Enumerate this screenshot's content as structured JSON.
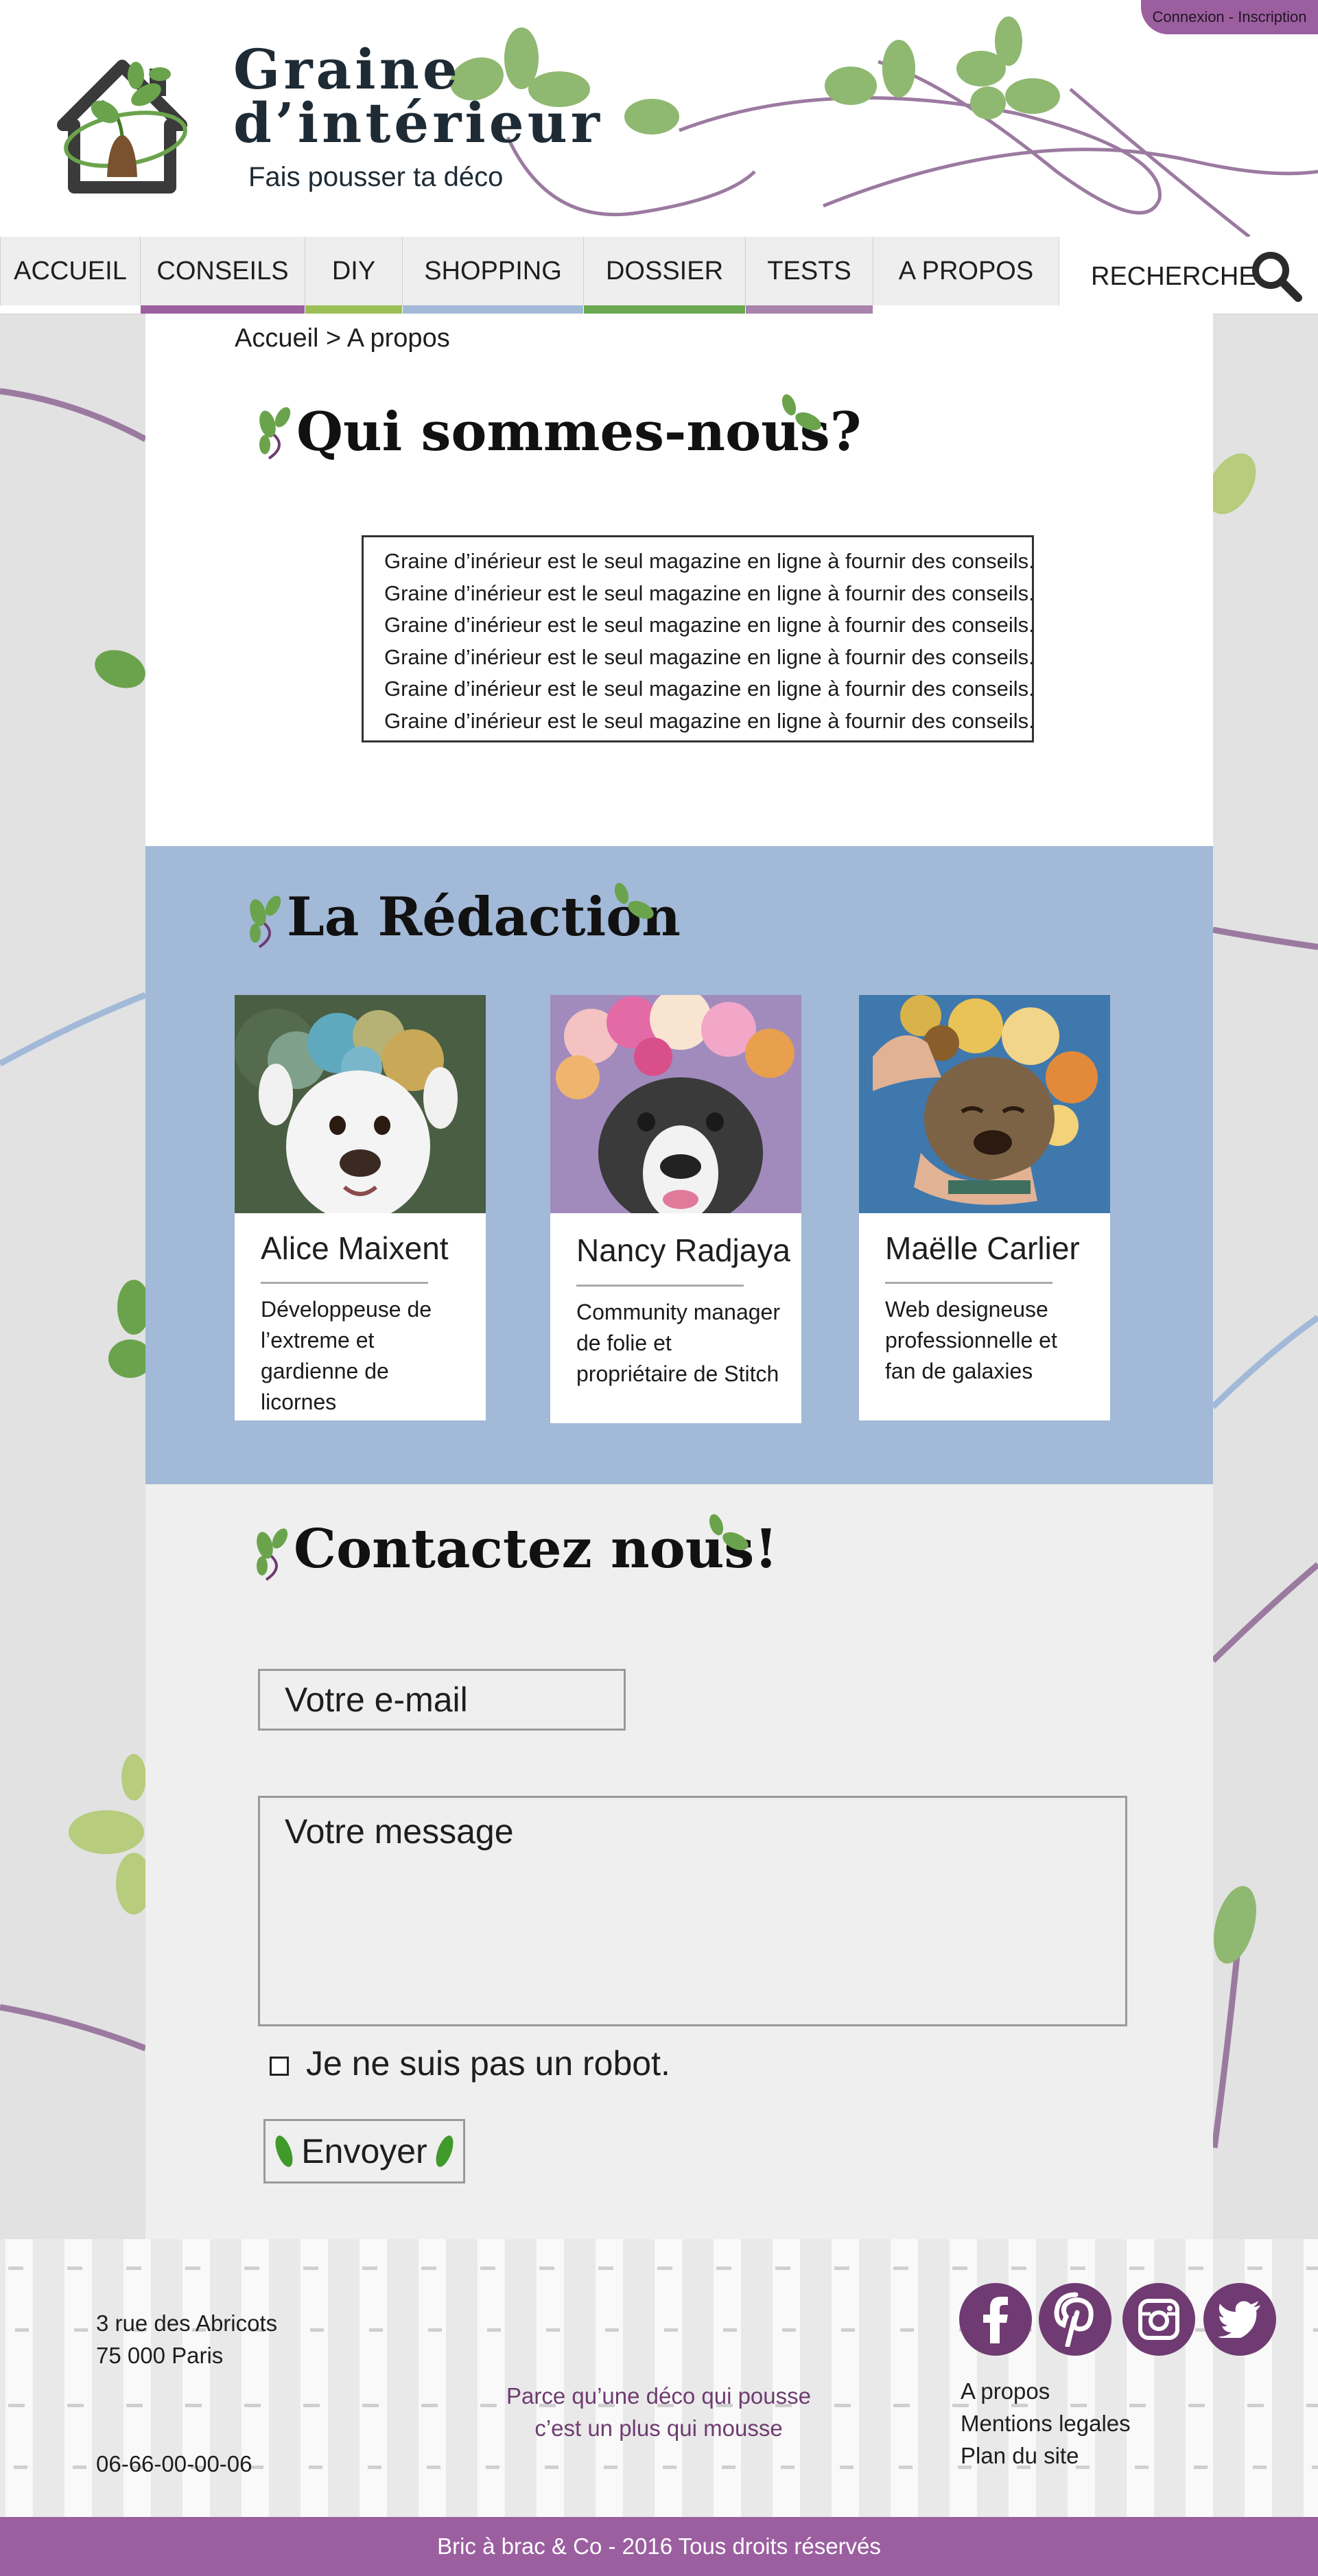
{
  "header": {
    "login_label": "Connexion - Inscription",
    "site_title_line1": "Graine",
    "site_title_line2": "d’intérieur",
    "tagline": "Fais pousser ta déco"
  },
  "nav": {
    "items": [
      {
        "label": "ACCUEIL",
        "accent": ""
      },
      {
        "label": "CONSEILS",
        "accent": "#9b5fa0"
      },
      {
        "label": "DIY",
        "accent": "#9cbf57"
      },
      {
        "label": "SHOPPING",
        "accent": "#a2b9d8"
      },
      {
        "label": "DOSSIER",
        "accent": "#6aa84f"
      },
      {
        "label": "TESTS",
        "accent": "#a983ac"
      },
      {
        "label": "A PROPOS",
        "accent": ""
      }
    ],
    "search_label": "RECHERCHE"
  },
  "breadcrumb": "Accueil > A propos",
  "about": {
    "title": "Qui sommes-nous?",
    "lines": [
      "Graine d’inérieur est le seul magazine en ligne à fournir des conseils.",
      "Graine d’inérieur est le seul magazine en ligne à fournir des conseils.",
      "Graine d’inérieur est le seul magazine en ligne à fournir des conseils.",
      "Graine d’inérieur est le seul magazine en ligne à fournir des conseils.",
      "Graine d’inérieur est le seul magazine en ligne à fournir des conseils.",
      "Graine d’inérieur est le seul magazine en ligne à fournir des conseils."
    ]
  },
  "team": {
    "title": "La Rédaction",
    "members": [
      {
        "name": "Alice Maixent",
        "role": "Développeuse de l’extreme et gardienne de licornes"
      },
      {
        "name": "Nancy Radjaya",
        "role": "Community manager de folie et propriétaire de Stitch"
      },
      {
        "name": "Maëlle Carlier",
        "role": "Web designeuse professionnelle et fan de galaxies"
      }
    ]
  },
  "contact": {
    "title": "Contactez nous!",
    "email_placeholder": "Votre e-mail",
    "message_placeholder": "Votre message",
    "robot_label": "Je ne suis pas un robot.",
    "send_label": "Envoyer"
  },
  "footer": {
    "address_line1": "3 rue des Abricots",
    "address_line2": "75 000 Paris",
    "phone": "06-66-00-00-06",
    "slogan_line1": "Parce qu’une déco qui pousse",
    "slogan_line2": "c’est un plus qui mousse",
    "social": [
      "facebook-icon",
      "pinterest-icon",
      "instagram-icon",
      "twitter-icon"
    ],
    "links": [
      "A propos",
      "Mentions legales",
      "Plan du site"
    ],
    "copyright": "Bric à brac & Co - 2016 Tous droits réservés"
  },
  "colors": {
    "accent_purple": "#9b5fa0",
    "dark_purple": "#6f3b72",
    "leaf_green": "#8fb870",
    "team_blue": "#a2b9d8"
  }
}
